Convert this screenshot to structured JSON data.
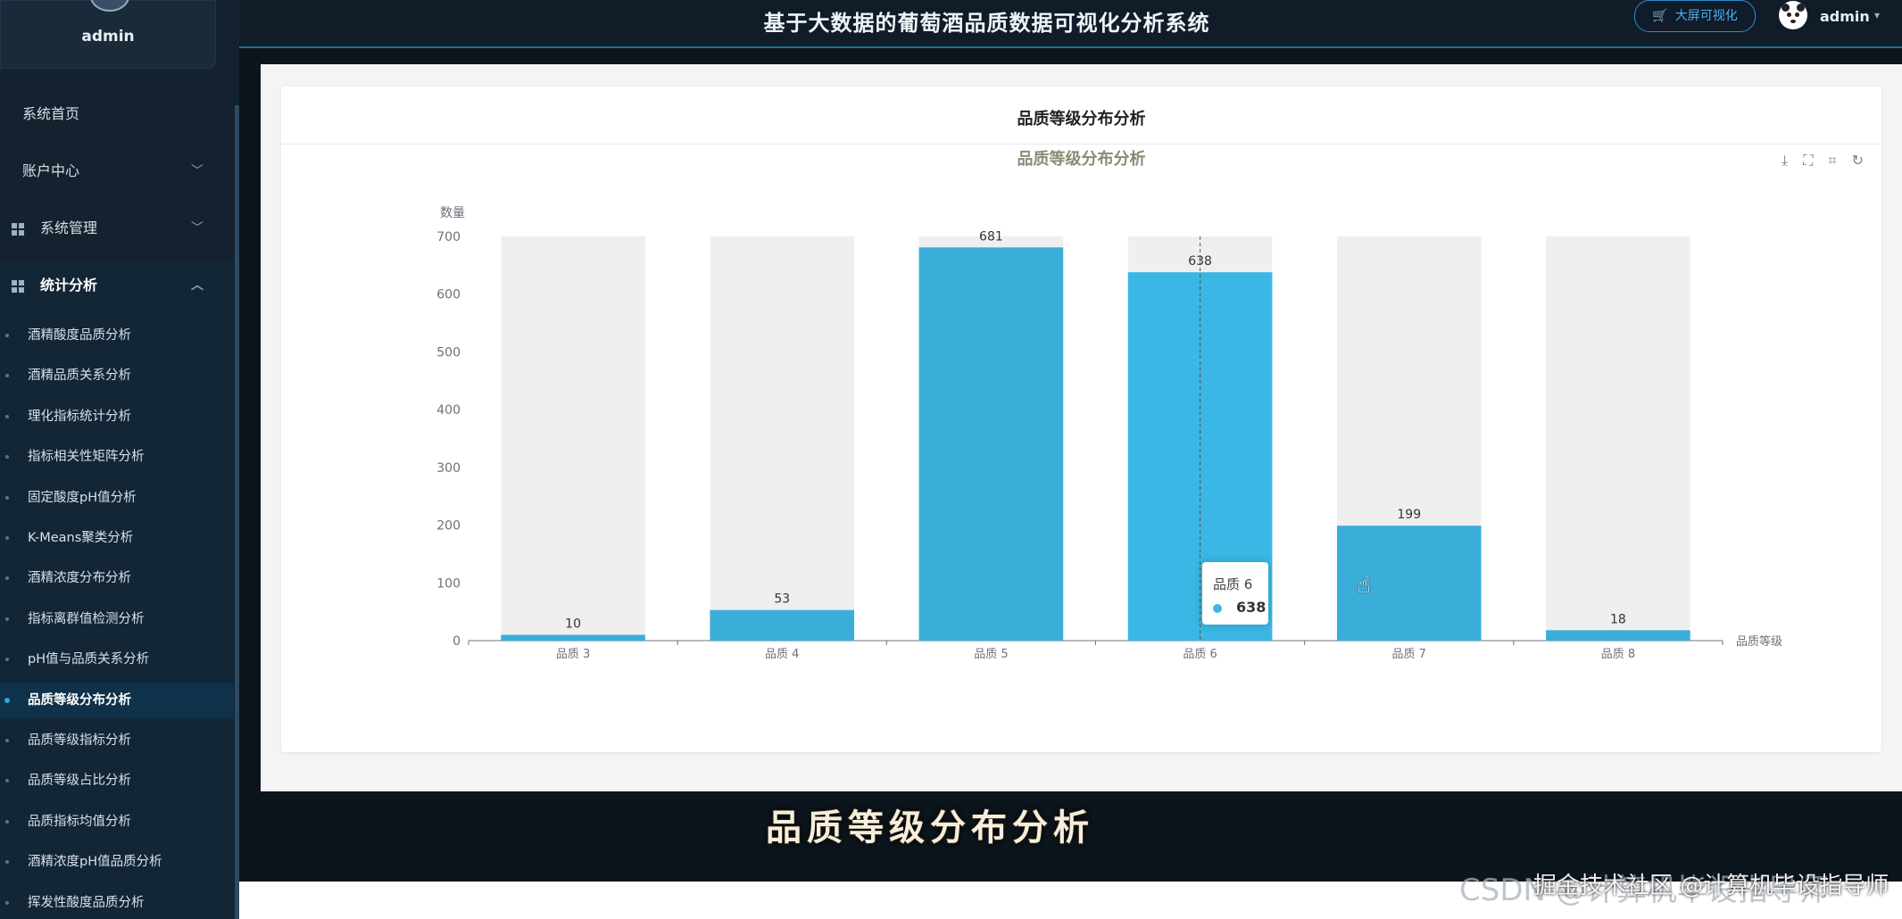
{
  "sidebar": {
    "username": "admin",
    "items": [
      {
        "label": "系统首页"
      },
      {
        "label": "账户中心"
      },
      {
        "label": "系统管理"
      },
      {
        "label": "统计分析"
      }
    ],
    "sub_items": [
      {
        "label": "酒精酸度品质分析"
      },
      {
        "label": "酒精品质关系分析"
      },
      {
        "label": "理化指标统计分析"
      },
      {
        "label": "指标相关性矩阵分析"
      },
      {
        "label": "固定酸度pH值分析"
      },
      {
        "label": "K-Means聚类分析"
      },
      {
        "label": "酒精浓度分布分析"
      },
      {
        "label": "指标离群值检测分析"
      },
      {
        "label": "pH值与品质关系分析"
      },
      {
        "label": "品质等级分布分析"
      },
      {
        "label": "品质等级指标分析"
      },
      {
        "label": "品质等级占比分析"
      },
      {
        "label": "品质指标均值分析"
      },
      {
        "label": "酒精浓度pH值品质分析"
      },
      {
        "label": "挥发性酸度品质分析"
      }
    ],
    "active_sub": "品质等级分布分析"
  },
  "header": {
    "title": "基于大数据的葡萄酒品质数据可视化分析系统",
    "big_screen_label": "大屏可视化",
    "username": "admin"
  },
  "card": {
    "title": "品质等级分布分析"
  },
  "chart_data": {
    "type": "bar",
    "title": "品质等级分布分析",
    "xlabel": "品质等级",
    "ylabel": "数量",
    "categories": [
      "品质 3",
      "品质 4",
      "品质 5",
      "品质 6",
      "品质 7",
      "品质 8"
    ],
    "values": [
      10,
      53,
      681,
      638,
      199,
      18
    ],
    "ylim": [
      0,
      700
    ],
    "yticks": [
      0,
      100,
      200,
      300,
      400,
      500,
      600,
      700
    ],
    "background_bars": true,
    "highlighted_category": "品质 6",
    "colors": {
      "bar": "#3aaed8",
      "bar_highlight": "#3ab7e4",
      "background_bar": "#efefef"
    }
  },
  "tooltip": {
    "name": "品质 6",
    "value": "638"
  },
  "caption": "品质等级分布分析",
  "watermark": "CSDN @计算机毕设指导师",
  "watermark_overlay": "掘金技术社区 @计算机毕设指导师"
}
